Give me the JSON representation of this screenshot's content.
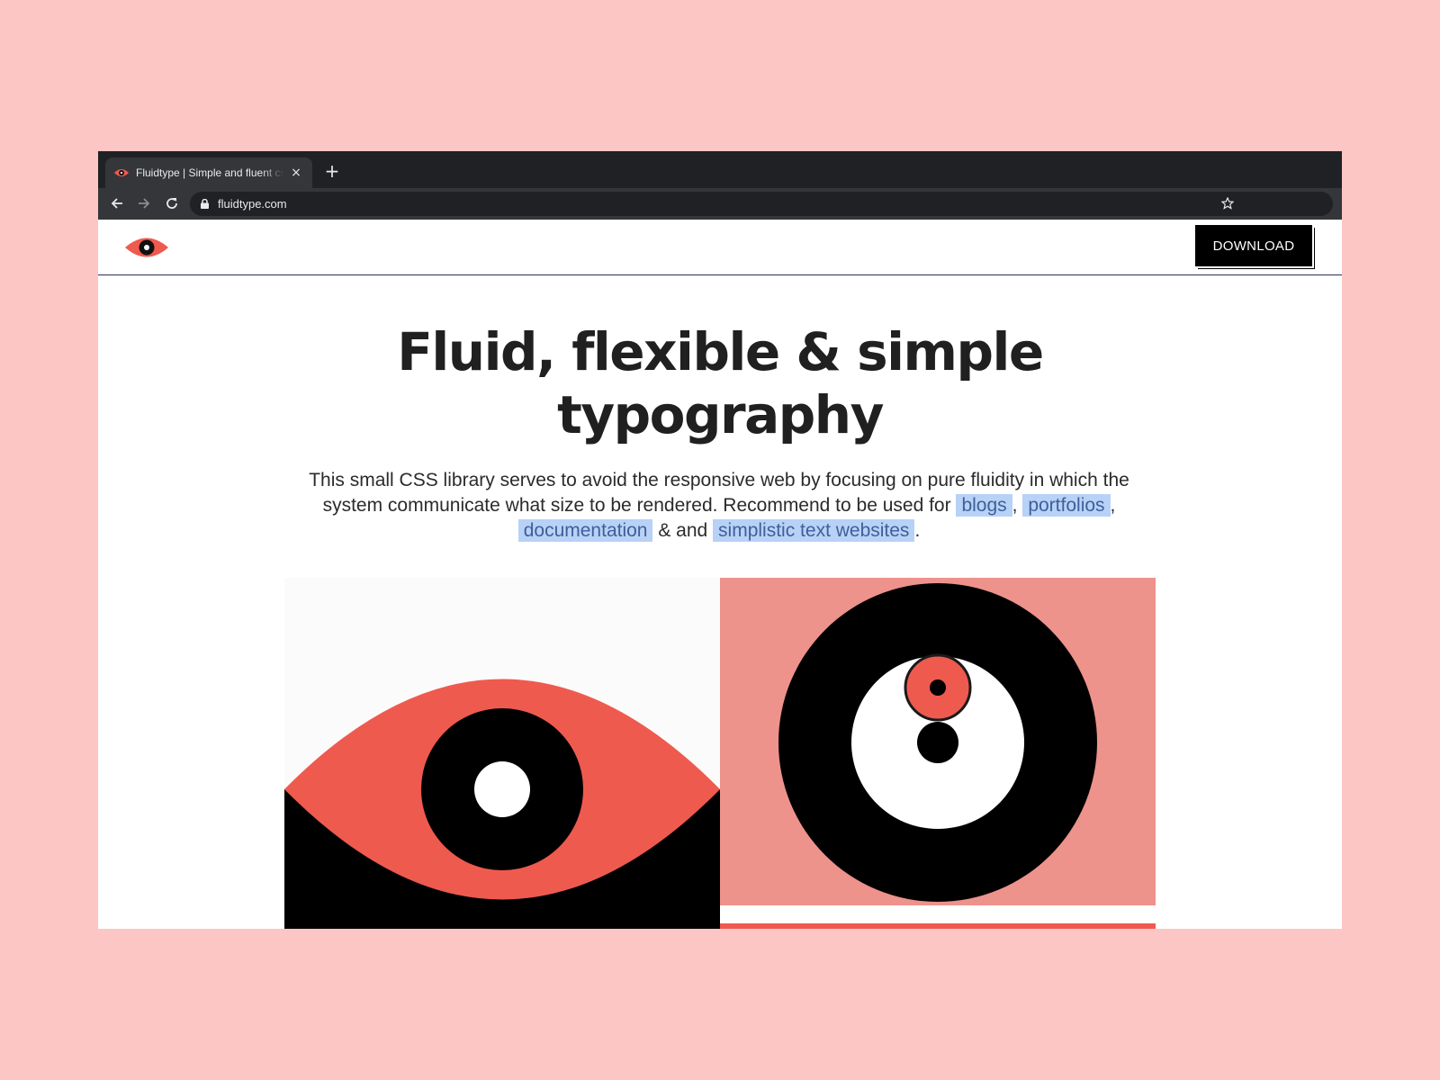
{
  "browser": {
    "tab_title": "Fluidtype | Simple and fluent css",
    "tab_close": "×",
    "new_tab": "+",
    "url": "fluidtype.com"
  },
  "header": {
    "logo": "eye-logo-icon",
    "download_label": "DOWNLOAD"
  },
  "hero": {
    "title_line1": "Fluid, flexible & simple",
    "title_line2": "typography",
    "desc_part1": "This small CSS library serves to avoid the responsive web by focusing on pure fluidity in which the system communicate what size to be rendered. Recommend to be used for ",
    "link_blogs": "blogs",
    "sep1": ",",
    "link_portfolios": "portfolios",
    "sep2": ",",
    "link_documentation": "documentation",
    "sep3": " & and ",
    "link_simplistic": "simplistic text websites",
    "sep4": "."
  },
  "colors": {
    "background": "#fbc6c4",
    "accent_red": "#ef5a4f",
    "salmon": "#ee928c",
    "highlight": "#b8d2f7",
    "dark": "#202020"
  }
}
